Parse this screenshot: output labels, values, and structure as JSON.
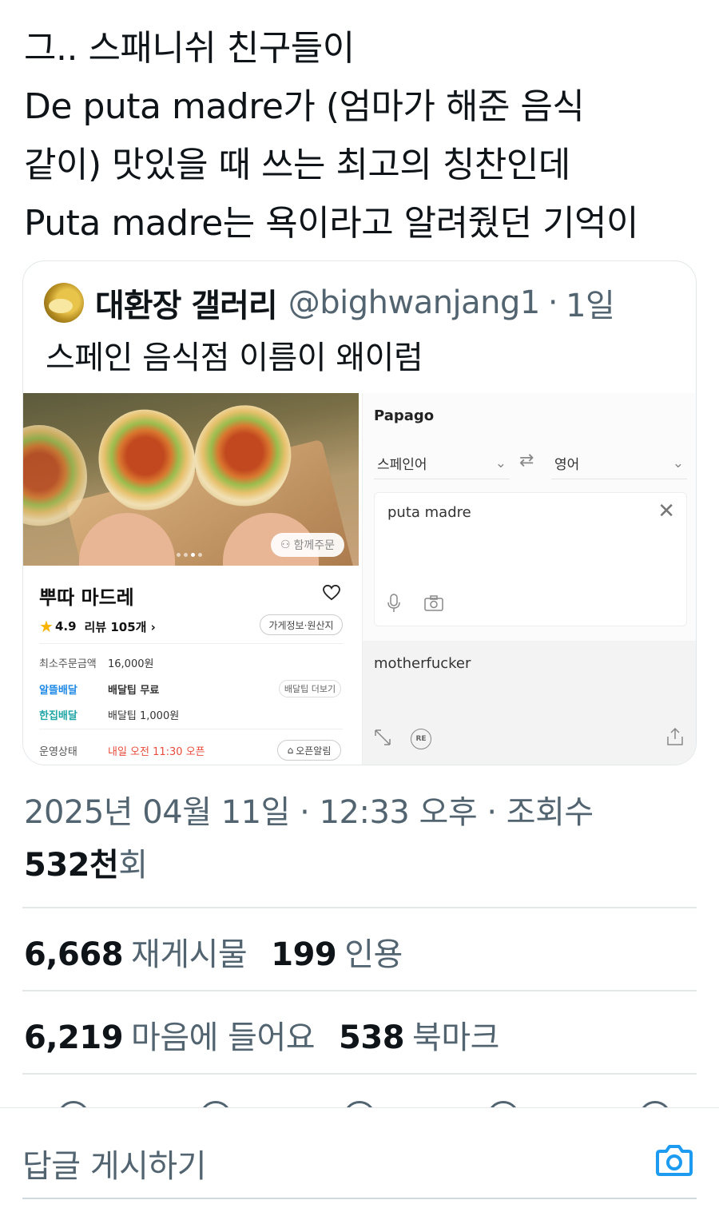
{
  "tweet": {
    "lines": [
      "그.. 스패니쉬 친구들이",
      "De puta madre가 (엄마가 해준 음식",
      "같이) 맛있을 때 쓰는 최고의 칭찬인데",
      "Puta madre는 욕이라고 알려줬던 기억이"
    ]
  },
  "quote": {
    "author_name": "대환장 갤러리",
    "handle": "@bighwanjang1",
    "separator": "·",
    "time": "1일",
    "text": "스페인 음식점 이름이 왜이럼"
  },
  "delivery_app": {
    "together_order": "함께주문",
    "store_name": "뿌따 마드레",
    "rating": "4.9",
    "reviews": "리뷰 105개 ›",
    "info_chip": "가게정보·원산지",
    "min_order_label": "최소주문금액",
    "min_order_value": "16,000원",
    "alddel_label": "알뜰배달",
    "alddel_value": "배달팁 무료",
    "tip_more": "배달팁 더보기",
    "hanjip_label": "한집배달",
    "hanjip_value": "배달팁 1,000원",
    "status_label": "운영상태",
    "status_value": "내일 오전 11:30 오픈",
    "open_alarm": "오픈알림"
  },
  "papago": {
    "brand": "Papago",
    "source_lang": "스페인어",
    "target_lang": "영어",
    "input_text": "puta madre",
    "output_text": "motherfucker",
    "re_label": "RE"
  },
  "meta": {
    "timestamp": "2025년 04월 11일 · 12:33 오후 · 조회수",
    "views_num": "532천",
    "views_unit": "회"
  },
  "stats": {
    "retweets_num": "6,668",
    "retweets_label": "재게시물",
    "quotes_num": "199",
    "quotes_label": "인용",
    "likes_num": "6,219",
    "likes_label": "마음에 들어요",
    "bookmarks_num": "538",
    "bookmarks_label": "북마크"
  },
  "reply": {
    "placeholder": "답글 게시하기"
  },
  "colors": {
    "text": "#0f1419",
    "secondary": "#536471",
    "accent": "#1d9bf0",
    "border": "#e5e8eb"
  }
}
